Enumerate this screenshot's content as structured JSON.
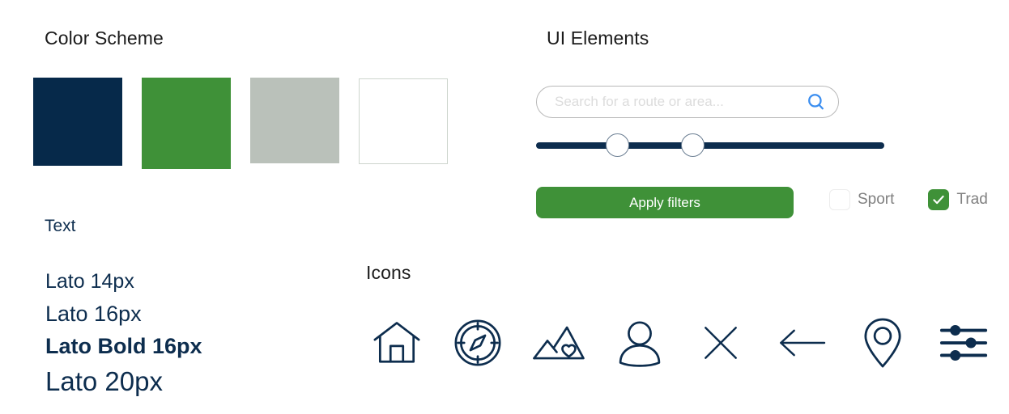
{
  "color_scheme": {
    "title": "Color Scheme",
    "swatches": [
      {
        "name": "navy",
        "hex": "#06294a"
      },
      {
        "name": "green",
        "hex": "#3f9138"
      },
      {
        "name": "gray",
        "hex": "#bac1ba"
      },
      {
        "name": "white",
        "hex": "#ffffff"
      }
    ]
  },
  "text": {
    "title": "Text",
    "specimens": [
      {
        "label": "Lato 14px"
      },
      {
        "label": "Lato 16px"
      },
      {
        "label": "Lato Bold 16px"
      },
      {
        "label": "Lato 20px"
      }
    ],
    "color": "#0d2d4e"
  },
  "ui_elements": {
    "title": "UI Elements",
    "search": {
      "placeholder": "Search for a route or area...",
      "value": "",
      "icon": "search-icon",
      "icon_color": "#3b8ef0"
    },
    "slider": {
      "track_color": "#0d2d4e",
      "min_handle_percent": 23,
      "max_handle_percent": 45
    },
    "apply_button": {
      "label": "Apply filters",
      "color": "#3f9138"
    },
    "checkboxes": [
      {
        "label": "Sport",
        "checked": false
      },
      {
        "label": "Trad",
        "checked": true
      }
    ]
  },
  "icons": {
    "title": "Icons",
    "items": [
      {
        "name": "home-icon"
      },
      {
        "name": "compass-icon"
      },
      {
        "name": "mountain-heart-icon"
      },
      {
        "name": "user-icon"
      },
      {
        "name": "close-icon"
      },
      {
        "name": "back-arrow-icon"
      },
      {
        "name": "map-pin-icon"
      },
      {
        "name": "filter-sliders-icon"
      }
    ],
    "color": "#0d2d4e"
  }
}
